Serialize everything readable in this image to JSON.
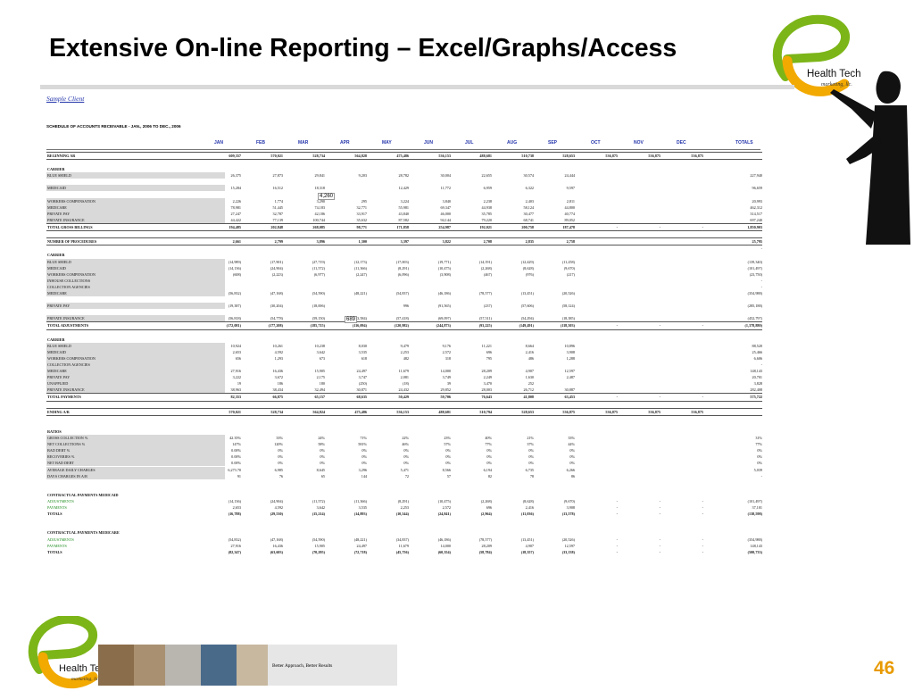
{
  "title": "Extensive On-line Reporting – Excel/Graphs/Access",
  "logo": {
    "line1": "Health Tech",
    "line2": "marketing, llc."
  },
  "tagline": "Better Approach, Better Results",
  "page_number": "46",
  "client": "Sample Client",
  "sheet_title": "SCHEDULE OF ACCOUNTS RECEIVABLE - JAN., 2006 TO DEC., 2006",
  "months": [
    "JAN",
    "FEB",
    "MAR",
    "APR",
    "MAY",
    "JUN",
    "JUL",
    "AUG",
    "SEP",
    "OCT",
    "NOV",
    "DEC",
    "TOTALS"
  ],
  "float_notes": [
    "4,260",
    "689"
  ],
  "rows": [
    {
      "label": "BEGINNING AR",
      "v": [
        "609,357",
        "570,021",
        "528,734",
        "564,828",
        "475,486",
        "536,153",
        "488,681",
        "510,738",
        "528,653",
        "536,875",
        "536,875",
        "536,875",
        ""
      ],
      "style": "hdr bot top"
    },
    {
      "label": "",
      "v": []
    },
    {
      "label": "CARRIER",
      "v": [],
      "style": "hdr"
    },
    {
      "label": "BLUE SHIELD",
      "v": [
        "26,375",
        "27,873",
        "29,841",
        "9,203",
        "28,782",
        "30,004",
        "22,655",
        "30,574",
        "24,444",
        "",
        "",
        "",
        "227,940"
      ],
      "shade": true
    },
    {
      "label": "",
      "v": []
    },
    {
      "label": "MEDICAID",
      "v": [
        "15,284",
        "16,512",
        "18,318",
        "",
        "12,429",
        "11,772",
        "6,959",
        "6,322",
        "9,597",
        "",
        "",
        "",
        "96,659"
      ],
      "shade": true
    },
    {
      "label": "",
      "v": []
    },
    {
      "label": "WORKERS COMPENSATION",
      "v": [
        "2,226",
        "1,774",
        "3,290",
        "295",
        "3,224",
        "3,840",
        "2,238",
        "2,403",
        "2,811",
        "",
        "",
        "",
        "20,993"
      ],
      "shade": true
    },
    {
      "label": "MEDICARE",
      "v": [
        "78,981",
        "51,445",
        "74,183",
        "32,771",
        "55,981",
        "69,347",
        "44,938",
        "58,124",
        "44,800",
        "",
        "",
        "",
        "462,312"
      ],
      "shade": true
    },
    {
      "label": "PRIVATE PAY",
      "v": [
        "27,247",
        "32,787",
        "42,186",
        "33,917",
        "43,840",
        "46,000",
        "35,785",
        "30,477",
        "40,774",
        "",
        "",
        "",
        "314,517"
      ],
      "shade": true
    },
    {
      "label": "PRIVATE INSURANCE",
      "v": [
        "44,422",
        "77,139",
        "100,744",
        "35,632",
        "87,582",
        "94,144",
        "79,220",
        "68,741",
        "89,052",
        "",
        "",
        "",
        "697,240"
      ],
      "shade": true
    },
    {
      "label": "TOTAL GROSS BILLINGS",
      "v": [
        "194,485",
        "202,848",
        "268,085",
        "98,771",
        "171,858",
        "254,987",
        "192,021",
        "200,758",
        "187,478",
        "-",
        "-",
        "-",
        "1,850,903"
      ],
      "style": "hdr top bot"
    },
    {
      "label": "",
      "v": []
    },
    {
      "label": "NUMBER OF PROCEDURES",
      "v": [
        "2,661",
        "2,799",
        "3,896",
        "1,300",
        "3,397",
        "3,822",
        "2,708",
        "2,835",
        "2,758",
        "",
        "",
        "",
        "25,795"
      ],
      "style": "hdr top bot"
    },
    {
      "label": "",
      "v": [
        "",
        "",
        "",
        "",
        "",
        "",
        "",
        "",
        "",
        "",
        "",
        "",
        "-"
      ]
    },
    {
      "label": "CARRIER",
      "v": [],
      "style": "hdr"
    },
    {
      "label": "BLUE SHIELD",
      "v": [
        "(14,989)",
        "(17,901)",
        "(27,719)",
        "(12,173)",
        "(17,003)",
        "(19,771)",
        "(14,191)",
        "(12,429)",
        "(11,258)",
        "",
        "",
        "",
        "(139,340)"
      ],
      "shade": true
    },
    {
      "label": "MEDICAID",
      "v": [
        "(14,136)",
        "(24,904)",
        "(11,572)",
        "(11,366)",
        "(8,291)",
        "(10,475)",
        "(2,268)",
        "(8,628)",
        "(9,670)",
        "",
        "",
        "",
        "(101,497)"
      ],
      "shade": true
    },
    {
      "label": "WORKERS COMPENSATION",
      "v": [
        "(608)",
        "(2,223)",
        "(6,977)",
        "(2,247)",
        "(6,096)",
        "(3,908)",
        "(467)",
        "(976)",
        "(217)",
        "",
        "",
        "",
        "(23,750)"
      ],
      "shade": true
    },
    {
      "label": "INHOUSE COLLECTIONS",
      "v": [
        "",
        "",
        "",
        "",
        "",
        "",
        "",
        "",
        "",
        "",
        "",
        "",
        "-"
      ],
      "shade": true
    },
    {
      "label": "COLLECTION AGENCIES",
      "v": [
        "",
        "",
        "",
        "",
        "",
        "",
        "",
        "",
        "",
        "",
        "",
        "",
        "-"
      ],
      "shade": true
    },
    {
      "label": "MEDICARE",
      "v": [
        "(56,832)",
        "(47,168)",
        "(54,590)",
        "(48,221)",
        "(54,837)",
        "(46,186)",
        "(78,577)",
        "(13,451)",
        "(20,526)",
        "",
        "",
        "",
        "(354,988)"
      ],
      "shade": true
    },
    {
      "label": "",
      "v": []
    },
    {
      "label": "PRIVATE PAY",
      "v": [
        "(19,387)",
        "(30,204)",
        "(18,006)",
        "",
        "996",
        "(91,565)",
        "(237)",
        "(57,606)",
        "(58,124)",
        "",
        "",
        "",
        "(285,188)"
      ],
      "shade": true
    },
    {
      "label": "",
      "v": []
    },
    {
      "label": "PRIVATE INSURANCE",
      "v": [
        "(56,818)",
        "(54,778)",
        "(59,150)",
        "(43,584)",
        "(57,418)",
        "(69,097)",
        "(57,511)",
        "(54,294)",
        "(18,385)",
        "",
        "",
        "",
        "(452,797)"
      ],
      "shade": true
    },
    {
      "label": "TOTAL ADJUSTMENTS",
      "v": [
        "(172,081)",
        "(177,208)",
        "(185,715)",
        "(116,094)",
        "(120,982)",
        "(244,873)",
        "(93,225)",
        "(149,491)",
        "(118,503)",
        "-",
        "-",
        "-",
        "(1,378,880)"
      ],
      "style": "hdr top bot"
    },
    {
      "label": "",
      "v": []
    },
    {
      "label": "CARRIER",
      "v": [],
      "style": "hdr"
    },
    {
      "label": "BLUE SHIELD",
      "v": [
        "10,924",
        "10,261",
        "10,238",
        "8,030",
        "9,479",
        "9,176",
        "11,221",
        "8,664",
        "10,896",
        "",
        "",
        "",
        "88,520"
      ],
      "shade": true
    },
    {
      "label": "MEDICAID",
      "v": [
        "2,653",
        "4,592",
        "3,642",
        "3,535",
        "2,253",
        "2,572",
        "696",
        "2,416",
        "3,908",
        "",
        "",
        "",
        "25,466"
      ],
      "shade": true
    },
    {
      "label": "WORKERS COMPENSATION",
      "v": [
        "656",
        "1,293",
        "673",
        "618",
        "482",
        "318",
        "795",
        "486",
        "1,288",
        "",
        "",
        "",
        "6,606"
      ],
      "shade": true
    },
    {
      "label": "COLLECTION AGENCIES",
      "v": [
        "",
        "",
        "",
        "",
        "",
        "",
        "",
        "",
        "",
        "",
        "",
        "",
        "-"
      ],
      "shade": true
    },
    {
      "label": "MEDICARE",
      "v": [
        "27,916",
        "16,436",
        "15,905",
        "24,497",
        "11,679",
        "14,000",
        "28,209",
        "4,907",
        "12,597",
        "",
        "",
        "",
        "148,143"
      ],
      "shade": true
    },
    {
      "label": "PRIVATE PAY",
      "v": [
        "3,222",
        "3,672",
        "2,175",
        "3,747",
        "2,081",
        "3,749",
        "2,249",
        "1,630",
        "2,487",
        "",
        "",
        "",
        "20,701"
      ],
      "shade": true
    },
    {
      "label": "UNAPPLIED",
      "v": [
        "19",
        "186",
        "180",
        "(250)",
        "(18)",
        "39",
        "3,470",
        "252",
        "",
        "",
        "",
        "",
        "3,828"
      ],
      "shade": true
    },
    {
      "label": "PRIVATE INSURANCE",
      "v": [
        "38,963",
        "38,434",
        "32,494",
        "30,871",
        "24,432",
        "29,852",
        "28,003",
        "26,712",
        "30,887",
        "",
        "",
        "",
        "282,408"
      ],
      "shade": true
    },
    {
      "label": "TOTAL PAYMENTS",
      "v": [
        "82,353",
        "66,875",
        "65,157",
        "68,635",
        "50,429",
        "59,706",
        "76,643",
        "41,808",
        "63,453",
        "-",
        "-",
        "-",
        "575,722"
      ],
      "style": "hdr top bot"
    },
    {
      "label": "",
      "v": []
    },
    {
      "label": "ENDING A/R",
      "v": [
        "570,021",
        "528,734",
        "564,824",
        "475,486",
        "536,153",
        "488,681",
        "510,794",
        "528,653",
        "536,875",
        "536,875",
        "536,875",
        "536,875",
        ""
      ],
      "style": "hdr top bot"
    },
    {
      "label": "",
      "v": []
    },
    {
      "label": "",
      "v": []
    },
    {
      "label": "RATIOS",
      "v": [],
      "style": "hdr"
    },
    {
      "label": "GROSS COLLECTION %",
      "v": [
        "42.35%",
        "33%",
        "24%",
        "71%",
        "22%",
        "23%",
        "40%",
        "21%",
        "33%",
        "",
        "",
        "",
        "31%"
      ],
      "shade": true
    },
    {
      "label": "NET COLLECTIONS %",
      "v": [
        "147%",
        "120%",
        "58%",
        "581%",
        "46%",
        "57%",
        "77%",
        "37%",
        "44%",
        "",
        "",
        "",
        "77%"
      ],
      "shade": true
    },
    {
      "label": "BAD DEBT %",
      "v": [
        "0.00%",
        "0%",
        "0%",
        "0%",
        "0%",
        "0%",
        "0%",
        "0%",
        "0%",
        "",
        "",
        "",
        "0%"
      ],
      "shade": true
    },
    {
      "label": "RECOVERIES %",
      "v": [
        "0.00%",
        "0%",
        "0%",
        "0%",
        "0%",
        "0%",
        "0%",
        "0%",
        "0%",
        "",
        "",
        "",
        "0%"
      ],
      "shade": true
    },
    {
      "label": "NET BAD DEBT",
      "v": [
        "0.00%",
        "0%",
        "0%",
        "0%",
        "0%",
        "0%",
        "0%",
        "0%",
        "0%",
        "",
        "",
        "",
        "0%"
      ],
      "shade": true
    },
    {
      "label": "AVERAGE DAILY CHARGES",
      "v": [
        "6,273.70",
        "6,985",
        "8,645",
        "3,296",
        "5,471",
        "8,566",
        "6,194",
        "6,735",
        "6,266",
        "",
        "",
        "",
        "5,039"
      ],
      "shade": true
    },
    {
      "label": "DAYS CHARGES IN A/R",
      "v": [
        "91",
        "76",
        "65",
        "144",
        "72",
        "57",
        "82",
        "78",
        "86",
        "",
        "",
        "",
        "-"
      ],
      "shade": true
    },
    {
      "label": "",
      "v": []
    },
    {
      "label": "",
      "v": []
    },
    {
      "label": "CONTRACTUAL PAYMENTS MEDICAID",
      "v": [],
      "style": "hdr"
    },
    {
      "label": "ADJUSTMENTS",
      "v": [
        "(14,136)",
        "(24,904)",
        "(11,572)",
        "(11,366)",
        "(8,291)",
        "(10,475)",
        "(2,268)",
        "(8,628)",
        "(9,670)",
        "-",
        "-",
        "-",
        "(101,497)"
      ],
      "style": "green"
    },
    {
      "label": "PAYMENTS",
      "v": [
        "2,653",
        "4,592",
        "3,642",
        "3,535",
        "2,253",
        "2,572",
        "696",
        "2,416",
        "3,908",
        "-",
        "-",
        "-",
        "37,101"
      ],
      "style": "green"
    },
    {
      "label": "TOTALS",
      "v": [
        "(16,788)",
        "(29,530)",
        "(15,214)",
        "(14,893)",
        "(10,544)",
        "(24,841)",
        "(2,964)",
        "(11,036)",
        "(13,578)",
        "-",
        "-",
        "-",
        "(138,598)"
      ],
      "style": "hdr"
    },
    {
      "label": "",
      "v": []
    },
    {
      "label": "",
      "v": []
    },
    {
      "label": "CONTRACTUAL PAYMENTS MEDICARE",
      "v": [],
      "style": "hdr"
    },
    {
      "label": "ADJUSTMENTS",
      "v": [
        "(54,832)",
        "(47,168)",
        "(54,590)",
        "(48,221)",
        "(34,837)",
        "(46,186)",
        "(78,577)",
        "(13,451)",
        "(20,526)",
        "-",
        "-",
        "-",
        "(354,988)"
      ],
      "style": "green"
    },
    {
      "label": "PAYMENTS",
      "v": [
        "27,916",
        "16,436",
        "15,905",
        "24,497",
        "11,679",
        "14,000",
        "28,209",
        "4,907",
        "12,597",
        "-",
        "-",
        "-",
        "148,143"
      ],
      "style": "green"
    },
    {
      "label": "TOTALS",
      "v": [
        "(82,347)",
        "(63,603)",
        "(70,295)",
        "(72,718)",
        "(45,756)",
        "(60,354)",
        "(58,784)",
        "(18,357)",
        "(33,138)",
        "-",
        "-",
        "-",
        "(500,733)"
      ],
      "style": "hdr"
    }
  ]
}
